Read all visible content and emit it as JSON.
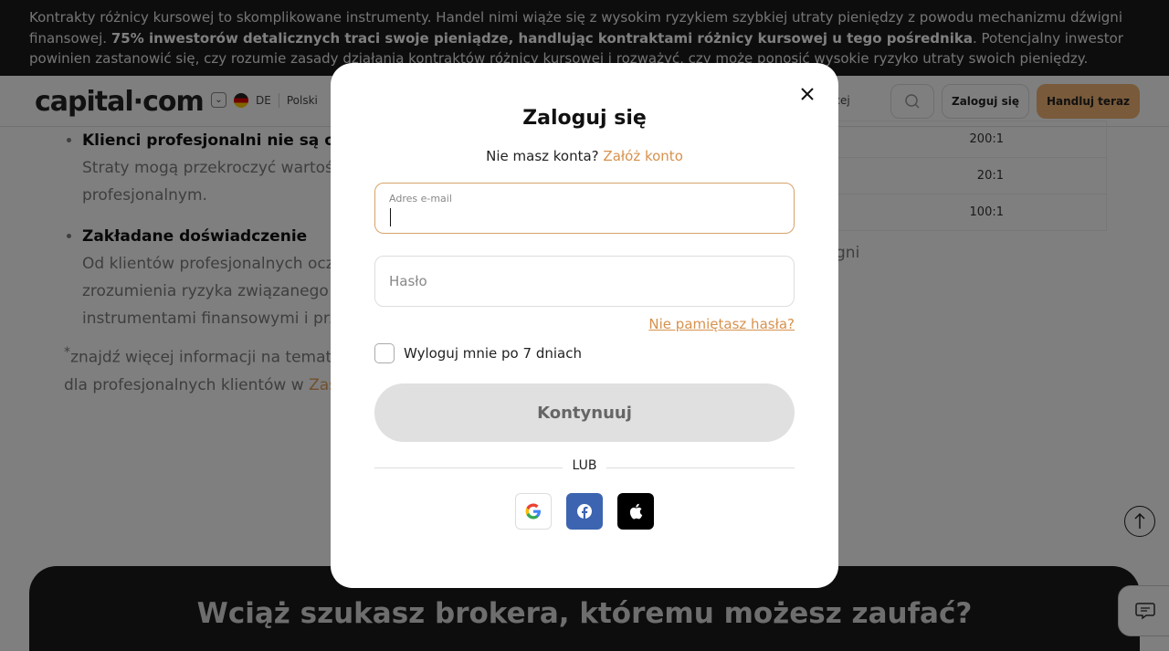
{
  "risk_banner": {
    "text_before": "Kontrakty różnicy kursowej to skomplikowane instrumenty. Handel nimi wiąże się z wysokim ryzykiem szybkiej utraty pieniędzy z powodu mechanizmu dźwigni finansowej. ",
    "bold": "75% inwestorów detalicznych traci swoje pieniądze, handlując kontraktami różnicy kursowej u tego pośrednika",
    "text_after": ". Potencjalny inwestor powinien zastanowić się, czy rozumie zasady działania kontraktów różnicy kursowej i rozważyć, czy może ponosić wysokie ryzyko utraty swoich pieniędzy."
  },
  "header": {
    "logo_left": "capital",
    "logo_dot": "·",
    "logo_right": "com",
    "country": "DE",
    "language": "Polski",
    "more_fragment": "ęcej",
    "login_label": "Zaloguj się",
    "trade_label": "Handluj teraz"
  },
  "content": {
    "item1_title": "Klienci profesjonalni nie są objęci",
    "item1_text": "Straty mogą przekroczyć wartość",
    "item1_text2": "profesjonalnym.",
    "item2_title": "Zakładane doświadczenie",
    "item2_text": "Od klientów profesjonalnych ocze",
    "item2_text2": "zrozumienia ryzyka związanego z",
    "item2_text3": "instrumentami finansowymi i prze",
    "footnote_text": "znajdź więcej informacji na temat o",
    "footnote_text2": "dla profesjonalnych klientów w ",
    "footnote_link": "Zasa",
    "tail_fragment": "gni"
  },
  "leverage_table": {
    "rows": [
      "200:1",
      "20:1",
      "100:1"
    ]
  },
  "promo": {
    "title": "Wciąż szukasz brokera, któremu możesz zaufać?"
  },
  "modal": {
    "title": "Zaloguj się",
    "no_account": "Nie masz konta? ",
    "signup_link": "Załóż konto",
    "email_label": "Adres e-mail",
    "email_value": "",
    "password_placeholder": "Hasło",
    "forgot": "Nie pamiętasz hasła?",
    "remember": "Wyloguj mnie po 7 dniach",
    "remember_checked": false,
    "continue": "Kontynuuj",
    "or": "LUB",
    "social": [
      "google-icon",
      "facebook-icon",
      "apple-icon"
    ]
  },
  "colors": {
    "accent": "#d7914d",
    "trade_button": "#f2b574",
    "facebook": "#3c64b1",
    "dark": "#1b1b1b"
  }
}
